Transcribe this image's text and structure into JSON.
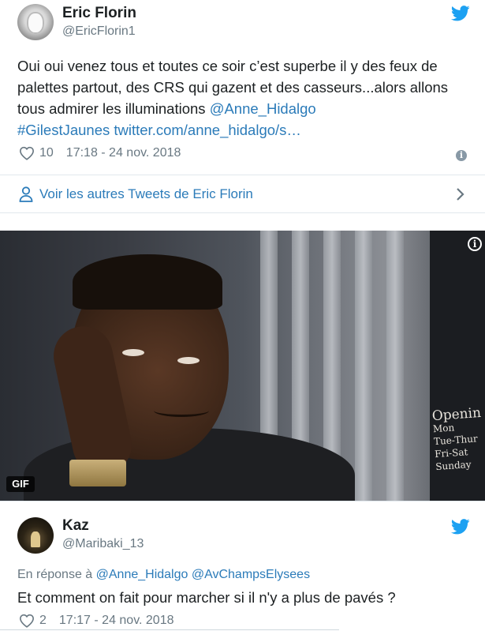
{
  "tweet1": {
    "author_name": "Eric Florin",
    "author_handle": "@EricFlorin1",
    "text_plain": "Oui oui venez tous et toutes ce soir c’est superbe il y des feux de palettes partout, des CRS qui gazent et des casseurs...alors allons tous admirer les illuminations ",
    "mention": "@Anne_Hidalgo",
    "hashtag": "#GilestJaunes",
    "link": "twitter.com/anne_hidalgo/s…",
    "likes": "10",
    "timestamp": "17:18 - 24 nov. 2018"
  },
  "more_tweets": {
    "label": "Voir les autres Tweets de Eric Florin"
  },
  "gif": {
    "badge": "GIF",
    "info": "i",
    "sign_lines": [
      "Openin",
      "Mon",
      "Tue-Thur",
      "Fri-Sat",
      "Sunday"
    ]
  },
  "tweet2": {
    "author_name": "Kaz",
    "author_handle": "@Maribaki_13",
    "reply_prefix": "En réponse à ",
    "reply_to": "@Anne_Hidalgo @AvChampsElysees",
    "text": "Et comment on fait pour marcher si il n'y a plus de pavés ?",
    "likes": "2",
    "timestamp": "17:17 - 24 nov. 2018"
  },
  "colors": {
    "link": "#2b7bb9",
    "twitter_blue": "#1da1f2",
    "secondary_text": "#697882"
  }
}
